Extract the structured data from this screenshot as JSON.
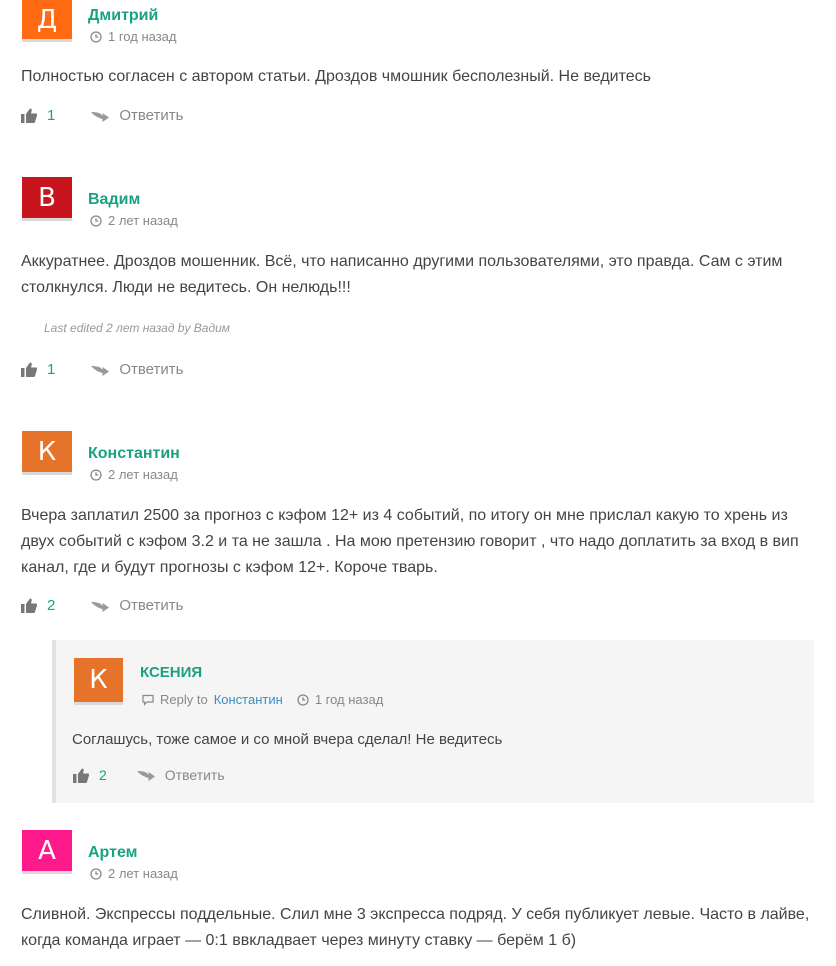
{
  "colors": {
    "author": "#1aa181",
    "link": "#3a8fc7",
    "avatar_d": "#ff6a13",
    "avatar_v": "#c8141c",
    "avatar_k": "#e5742a",
    "avatar_a": "#ff1a8c"
  },
  "comments": [
    {
      "avatar_letter": "Д",
      "author": "Дмитрий",
      "time": "1 год назад",
      "text": "Полностью согласен с автором статьи. Дроздов чмошник бесполезный. Не ведитесь",
      "likes": "1",
      "reply_label": "Ответить"
    },
    {
      "avatar_letter": "В",
      "author": "Вадим",
      "time": "2 лет назад",
      "text": "Аккуратнее. Дроздов мошенник. Всё, что написанно другими пользователями, это правда. Сам с этим столкнулся. Люди не ведитесь. Он нелюдь!!!",
      "edited": "Last edited 2 лет назад by Вадим",
      "likes": "1",
      "reply_label": "Ответить"
    },
    {
      "avatar_letter": "К",
      "author": "Константин",
      "time": "2 лет назад",
      "text": "Вчера заплатил 2500 за прогноз с кэфом 12+ из 4 событий, по итогу он мне прислал какую то хрень из двух событий с кэфом 3.2 и та не зашла . На мою претензию говорит , что надо доплатить за вход в вип канал, где и будут прогнозы с кэфом 12+. Короче тварь.",
      "likes": "2",
      "reply_label": "Ответить"
    },
    {
      "avatar_letter": "К",
      "author": "КСЕНИЯ",
      "reply_to_label": "Reply to",
      "reply_to_name": "Константин",
      "time": "1 год назад",
      "text": "Соглашусь, тоже самое и со мной вчера сделал! Не ведитесь",
      "likes": "2",
      "reply_label": "Ответить"
    },
    {
      "avatar_letter": "А",
      "author": "Артем",
      "time": "2 лет назад",
      "text": "Сливной. Экспрессы поддельные. Слил мне 3 экспресса подряд. У себя публикует левые. Часто в лайве, когда команда играет — 0:1 ввкладвает через минуту ставку — берём 1 б)"
    }
  ]
}
